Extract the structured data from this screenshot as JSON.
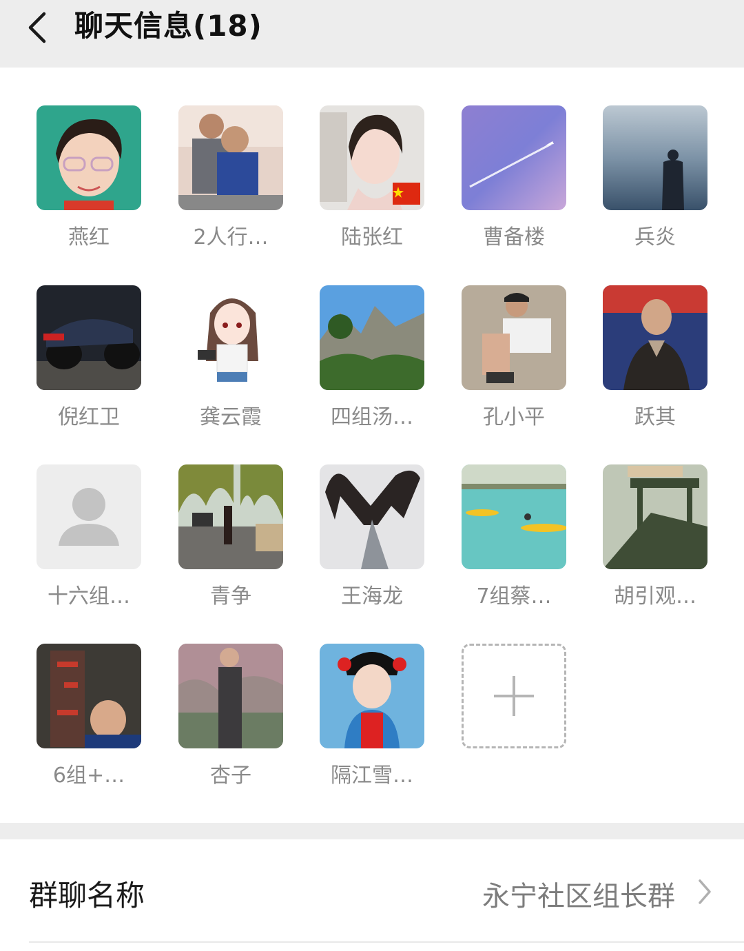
{
  "header": {
    "title": "聊天信息(18)"
  },
  "members": [
    {
      "name": "燕红",
      "icon": "girl-glasses-photo"
    },
    {
      "name": "2人行…",
      "icon": "man-child-photo"
    },
    {
      "name": "陆张红",
      "icon": "woman-flag-photo"
    },
    {
      "name": "曹备楼",
      "icon": "airplane-sky-photo"
    },
    {
      "name": "兵炎",
      "icon": "man-sea-photo"
    },
    {
      "name": "倪红卫",
      "icon": "motorcycle-photo"
    },
    {
      "name": "龚云霞",
      "icon": "cartoon-girl-camera"
    },
    {
      "name": "四组汤…",
      "icon": "mountain-photo"
    },
    {
      "name": "孔小平",
      "icon": "boy-sitting-photo"
    },
    {
      "name": "跃其",
      "icon": "elder-man-photo"
    },
    {
      "name": "十六组…",
      "icon": "default-avatar-icon"
    },
    {
      "name": "青争",
      "icon": "park-walk-photo"
    },
    {
      "name": "王海龙",
      "icon": "hands-tower-photo"
    },
    {
      "name": "7组蔡…",
      "icon": "kayak-sea-photo"
    },
    {
      "name": "胡引观…",
      "icon": "old-march-photo"
    },
    {
      "name": "6组+…",
      "icon": "man-rock-photo"
    },
    {
      "name": "杏子",
      "icon": "woman-tree-photo"
    },
    {
      "name": "隔江雪…",
      "icon": "girl-costume-photo"
    }
  ],
  "add_button": {
    "icon": "plus-icon"
  },
  "group_name_row": {
    "label": "群聊名称",
    "value": "永宁社区组长群"
  },
  "colors": {
    "header_bg": "#ededed",
    "name_gray": "#8a8a8a",
    "value_gray": "#7d7d7d"
  }
}
